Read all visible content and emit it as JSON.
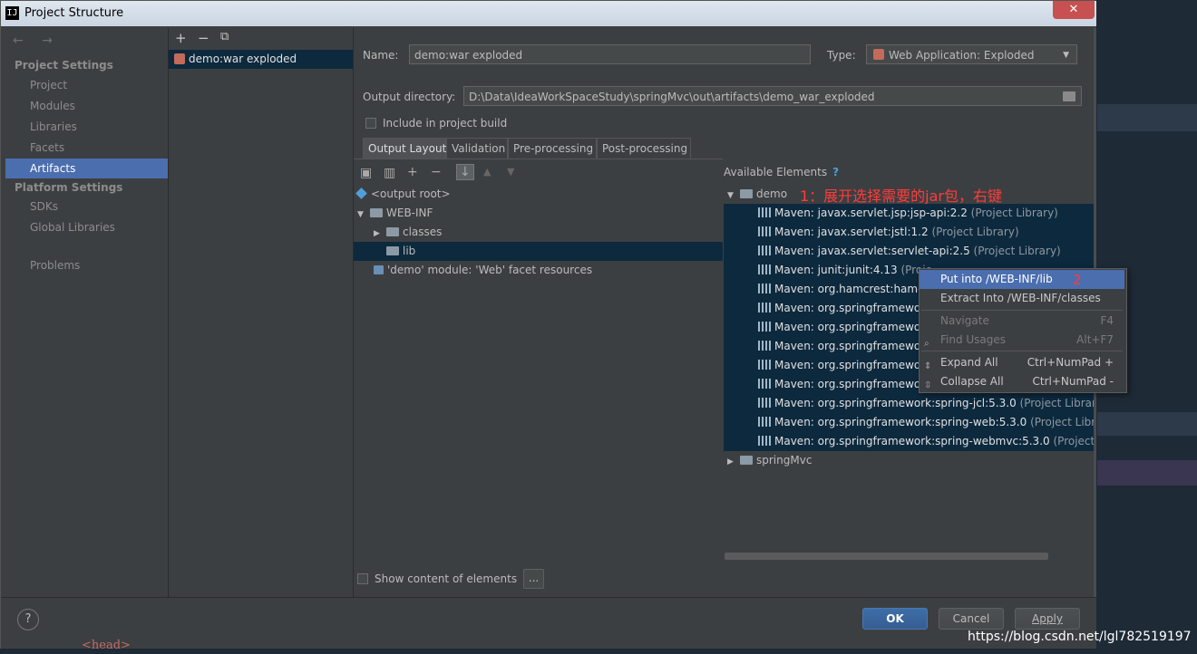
{
  "window": {
    "title": "Project Structure",
    "app_icon": "IJ",
    "close_glyph": "✕"
  },
  "nav": {
    "arrows": "← →",
    "project_settings_header": "Project Settings",
    "project_items": [
      "Project",
      "Modules",
      "Libraries",
      "Facets",
      "Artifacts"
    ],
    "platform_settings_header": "Platform Settings",
    "platform_items": [
      "SDKs",
      "Global Libraries"
    ],
    "problems": "Problems",
    "selected": "Artifacts"
  },
  "artifacts_toolbar": {
    "add": "+",
    "remove": "−",
    "copy": "⧉"
  },
  "artifacts": [
    {
      "name": "demo:war exploded"
    }
  ],
  "config": {
    "name_label": "Name:",
    "name_value": "demo:war exploded",
    "type_label": "Type:",
    "type_value": "Web Application: Exploded",
    "output_dir_label": "Output directory:",
    "output_dir_value": "D:\\Data\\IdeaWorkSpaceStudy\\springMvc\\out\\artifacts\\demo_war_exploded",
    "include_build_label": "Include in project build",
    "include_build_checked": false
  },
  "tabs": [
    "Output Layout",
    "Validation",
    "Pre-processing",
    "Post-processing"
  ],
  "selected_tab": "Output Layout",
  "layout_tree": {
    "output_root": "<output root>",
    "web_inf": "WEB-INF",
    "classes": "classes",
    "lib": "lib",
    "facet_resources": "'demo' module: 'Web' facet resources"
  },
  "available": {
    "title": "Available Elements",
    "help": "?",
    "demo_node": "demo",
    "spring_node": "springMvc",
    "libraries": [
      {
        "name": "Maven: javax.servlet.jsp:jsp-api:2.2",
        "suffix": "(Project Library)"
      },
      {
        "name": "Maven: javax.servlet:jstl:1.2",
        "suffix": "(Project Library)"
      },
      {
        "name": "Maven: javax.servlet:servlet-api:2.5",
        "suffix": "(Project Library)"
      },
      {
        "name": "Maven: junit:junit:4.13",
        "suffix": "(Proje"
      },
      {
        "name": "Maven: org.hamcrest:hamc",
        "suffix": ""
      },
      {
        "name": "Maven: org.springframewo",
        "suffix": ""
      },
      {
        "name": "Maven: org.springframewo",
        "suffix": ""
      },
      {
        "name": "Maven: org.springframewo",
        "suffix": ""
      },
      {
        "name": "Maven: org.springframewo",
        "suffix": ""
      },
      {
        "name": "Maven: org.springframewo",
        "suffix": ""
      },
      {
        "name": "Maven: org.springframework:spring-jcl:5.3.0",
        "suffix": "(Project Library)"
      },
      {
        "name": "Maven: org.springframework:spring-web:5.3.0",
        "suffix": "(Project Libra"
      },
      {
        "name": "Maven: org.springframework:spring-webmvc:5.3.0",
        "suffix": "(Project L"
      }
    ]
  },
  "annotations": {
    "step1": "1：展开选择需要的jar包，右键",
    "step2": "2"
  },
  "context_menu": {
    "put_into": "Put into /WEB-INF/lib",
    "extract_into": "Extract Into /WEB-INF/classes",
    "navigate": "Navigate",
    "navigate_shortcut": "F4",
    "find_usages": "Find Usages",
    "find_usages_shortcut": "Alt+F7",
    "expand_all": "Expand All",
    "expand_all_shortcut": "Ctrl+NumPad +",
    "collapse_all": "Collapse All",
    "collapse_all_shortcut": "Ctrl+NumPad -"
  },
  "bottom": {
    "show_content_label": "Show content of elements",
    "ellipsis": "...",
    "help": "?",
    "ok": "OK",
    "cancel": "Cancel",
    "apply": "Apply"
  },
  "watermark": "https://blog.csdn.net/lgl782519197",
  "background_text": "<head>",
  "colors": {
    "panel_bg": "#3c3f41",
    "selection": "#4b6eaf",
    "tree_selection": "#0d293e",
    "annotation_red": "#ff3b3b"
  }
}
